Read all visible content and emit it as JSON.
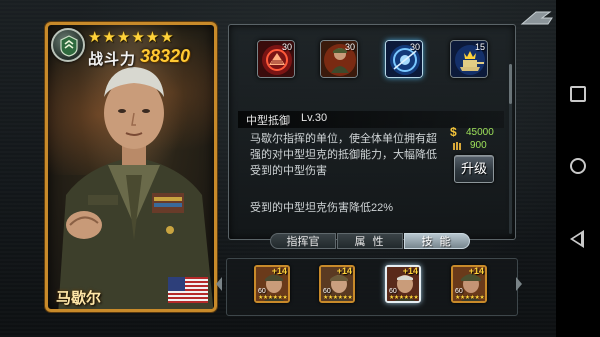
{
  "hero": {
    "name": "马歇尔",
    "stars": "★★★★★★",
    "power_label": "战斗力",
    "power_value": "38320",
    "rank_icon": "rank-badge-icon",
    "flag": "usa-flag"
  },
  "skills": {
    "icons": [
      {
        "name": "skill-defense-icon",
        "level": "30"
      },
      {
        "name": "skill-soldier-icon",
        "level": "30"
      },
      {
        "name": "skill-radar-icon",
        "level": "30"
      },
      {
        "name": "skill-tank-icon",
        "level": "15"
      }
    ],
    "selected": {
      "name": "中型抵御",
      "level": "Lv.30",
      "description": "马歇尔指挥的单位，使全体单位拥有超强的对中型坦克的抵御能力，大幅降低受到的中型伤害",
      "effect": "受到的中型坦克伤害降低22%"
    },
    "cost": {
      "gold_symbol": "$",
      "gold": "45000",
      "ammo": "900"
    },
    "upgrade_label": "升级"
  },
  "tabs": [
    {
      "label": "指挥官"
    },
    {
      "label": "属 性"
    },
    {
      "label": "技 能",
      "active": true
    }
  ],
  "roster": [
    {
      "plus": "+14",
      "level": "60",
      "stars": "★★★★★★"
    },
    {
      "plus": "+14",
      "level": "60",
      "stars": "★★★★★★"
    },
    {
      "plus": "+14",
      "level": "60",
      "stars": "★★★★★★",
      "selected": true
    },
    {
      "plus": "+14",
      "level": "60",
      "stars": "★★★★★★"
    }
  ],
  "colors": {
    "gold": "#c88a2a",
    "star": "#ffd23a",
    "power": "#ffc933",
    "cost_text": "#9fe35a"
  }
}
